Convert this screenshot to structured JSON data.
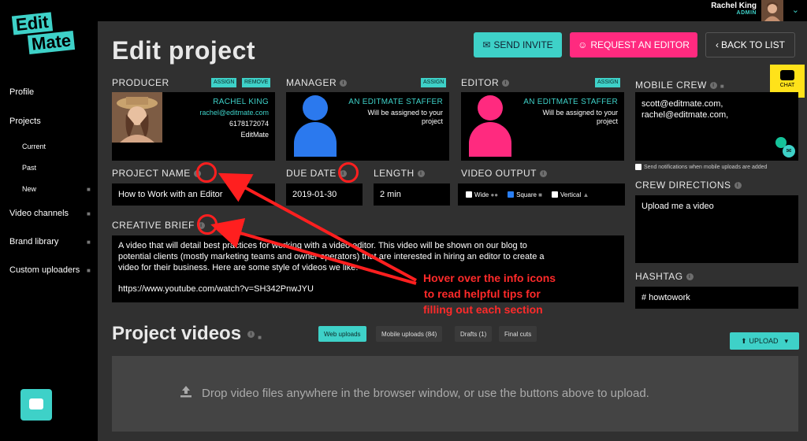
{
  "user": {
    "name": "Rachel King",
    "role": "ADMIN"
  },
  "logo": {
    "line1": "Edit",
    "line2": "Mate"
  },
  "sidebar": {
    "items": [
      {
        "label": "Profile"
      },
      {
        "label": "Projects"
      },
      {
        "label": "Current"
      },
      {
        "label": "Past"
      },
      {
        "label": "New"
      },
      {
        "label": "Video channels"
      },
      {
        "label": "Brand library"
      },
      {
        "label": "Custom uploaders"
      }
    ]
  },
  "header": {
    "title": "Edit project",
    "send_invite": "SEND INVITE",
    "request_editor": "REQUEST AN EDITOR",
    "back_to_list": "BACK TO LIST",
    "chat": "CHAT"
  },
  "producer": {
    "label": "PRODUCER",
    "assign": "ASSIGN",
    "remove": "REMOVE",
    "name": "RACHEL KING",
    "email": "rachel@editmate.com",
    "phone": "6178172074",
    "company": "EditMate"
  },
  "manager": {
    "label": "MANAGER",
    "assign": "ASSIGN",
    "name": "AN EDITMATE STAFFER",
    "note1": "Will be assigned to your",
    "note2": "project"
  },
  "editor": {
    "label": "EDITOR",
    "assign": "ASSIGN",
    "name": "AN EDITMATE STAFFER",
    "note1": "Will be assigned to your",
    "note2": "project"
  },
  "mobile_crew": {
    "label": "MOBILE CREW",
    "line1": "scott@editmate.com,",
    "line2": "rachel@editmate.com,",
    "notify": "Send notifications when mobile uploads are added"
  },
  "project_name": {
    "label": "PROJECT NAME",
    "value": "How to Work with an Editor"
  },
  "due_date": {
    "label": "DUE DATE",
    "value": "2019-01-30"
  },
  "length": {
    "label": "LENGTH",
    "value": "2 min"
  },
  "video_output": {
    "label": "VIDEO OUTPUT",
    "options": [
      {
        "label": "Wide",
        "checked": false
      },
      {
        "label": "Square",
        "checked": true
      },
      {
        "label": "Vertical",
        "checked": false
      }
    ]
  },
  "crew_directions": {
    "label": "CREW DIRECTIONS",
    "value": "Upload me a video"
  },
  "hashtag": {
    "label": "HASHTAG",
    "value": "# howtowork"
  },
  "creative_brief": {
    "label": "CREATIVE BRIEF",
    "line1": "A video that will detail best practices for working with a video editor. This video will be shown on our blog to",
    "line2": "potential clients (mostly marketing teams and owner operators) that are interested in hiring an editor to create a",
    "line3": "video for their business. Here are some style of videos we like:",
    "link": "https://www.youtube.com/watch?v=SH342PnwJYU"
  },
  "annotation": {
    "line1": "Hover over the info icons",
    "line2": "to read helpful tips for",
    "line3": "filling out each section"
  },
  "videos": {
    "title": "Project videos",
    "tabs": [
      {
        "label": "Web uploads",
        "active": true
      },
      {
        "label": "Mobile uploads (84)",
        "active": false
      },
      {
        "label": "Drafts (1)",
        "active": false
      },
      {
        "label": "Final cuts",
        "active": false
      }
    ],
    "upload": "UPLOAD",
    "drop_text": "Drop video files anywhere in the browser window, or use the buttons above to upload."
  },
  "colors": {
    "accent": "#3ed1c8",
    "pink": "#ff2a7f",
    "blue": "#2b79ee",
    "annotation": "#ff2a2a",
    "chat": "#ffe21a"
  }
}
